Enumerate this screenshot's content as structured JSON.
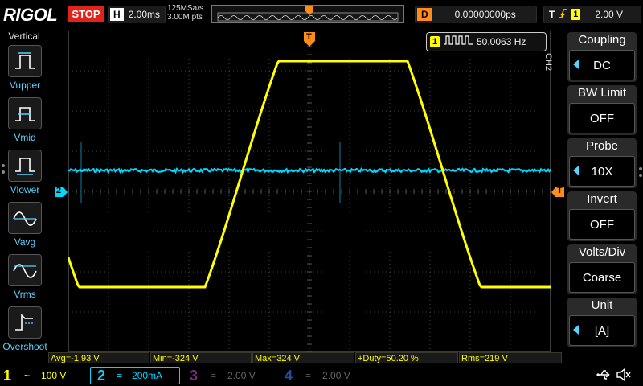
{
  "header": {
    "brand": "RIGOL",
    "run_state": "STOP",
    "horizontal_key": "H",
    "timebase": "2.00ms",
    "sample_rate": "125MSa/s",
    "memory_depth": "3.00M pts",
    "delay_key": "D",
    "delay_value": "0.00000000ps",
    "trigger_key": "T",
    "trigger_channel": "1",
    "trigger_level": "2.00 V"
  },
  "left_panel": {
    "title": "Vertical",
    "items": [
      {
        "label": "Vupper",
        "icon": "vupper-icon"
      },
      {
        "label": "Vmid",
        "icon": "vmid-icon"
      },
      {
        "label": "Vlower",
        "icon": "vlower-icon"
      },
      {
        "label": "Vavg",
        "icon": "vavg-icon"
      },
      {
        "label": "Vrms",
        "icon": "vrms-icon"
      },
      {
        "label": "Overshoot",
        "icon": "overshoot-icon"
      }
    ]
  },
  "frequency_counter": {
    "channel": "1",
    "value": "50.0063 Hz"
  },
  "markers": {
    "trigger_top": "T",
    "ch2_marker": "2",
    "trigger_level_marker": "T"
  },
  "right_panel": {
    "channel_tag": "CH2",
    "buttons": [
      {
        "title": "Coupling",
        "value": "DC",
        "arrow": true
      },
      {
        "title": "BW Limit",
        "value": "OFF",
        "arrow": false
      },
      {
        "title": "Probe",
        "value": "10X",
        "arrow": true
      },
      {
        "title": "Invert",
        "value": "OFF",
        "arrow": false
      },
      {
        "title": "Volts/Div",
        "value": "Coarse",
        "arrow": false
      },
      {
        "title": "Unit",
        "value": "[A]",
        "arrow": true
      }
    ]
  },
  "measurements": {
    "avg": "Avg=-1.93 V",
    "min": "Min=-324 V",
    "max": "Max=324 V",
    "duty": "+Duty=50.20 %",
    "rms": "Rms=219 V"
  },
  "channels": [
    {
      "num": "1",
      "coupling_symbol": "~",
      "scale": "100 V",
      "color": "#ffff00",
      "active": false
    },
    {
      "num": "2",
      "coupling_symbol": "=",
      "scale": "200mA",
      "color": "#00d8ff",
      "active": true
    },
    {
      "num": "3",
      "coupling_symbol": "=",
      "scale": "2.00 V",
      "color": "#c03cc0",
      "active": false
    },
    {
      "num": "4",
      "coupling_symbol": "=",
      "scale": "2.00 V",
      "color": "#3a6ad8",
      "active": false
    }
  ],
  "colors": {
    "ch1": "#ffff00",
    "ch2": "#00d8ff",
    "trigger": "#ff8c1a",
    "stop": "#e2231a",
    "accent": "#5ad2ff"
  },
  "status_icons": [
    "usb-icon",
    "speaker-muted-icon"
  ]
}
